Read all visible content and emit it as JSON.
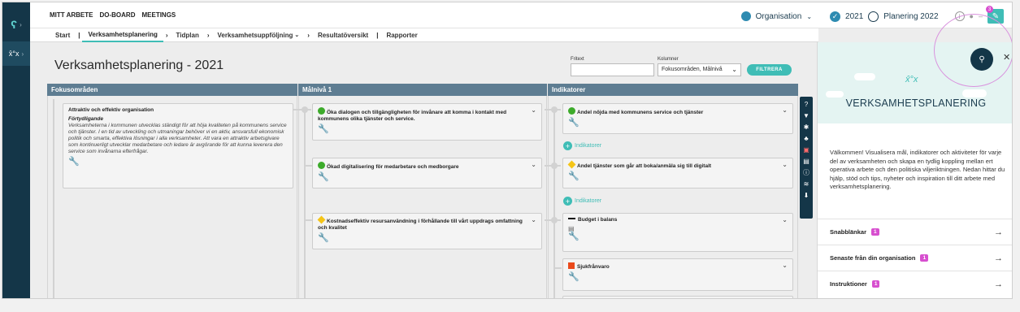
{
  "topnav": {
    "items": [
      "MITT ARBETE",
      "DO-BOARD",
      "MEETINGS"
    ]
  },
  "topbar": {
    "organisation_label": "Organisation",
    "year_label": "2021",
    "plan_label": "Planering 2022",
    "notif_count": "3"
  },
  "subnav": {
    "items": [
      {
        "label": "Start"
      },
      {
        "label": "Verksamhetsplanering"
      },
      {
        "label": "Tidplan"
      },
      {
        "label": "Verksamhetsuppföljning"
      },
      {
        "label": "Resultatöversikt"
      },
      {
        "label": "Rapporter"
      }
    ]
  },
  "page": {
    "title": "Verksamhetsplanering - 2021"
  },
  "filters": {
    "fritext_label": "Fritext",
    "fritext_value": "",
    "columns_label": "Kolumner",
    "columns_value": "Fokusområden, Målnivå",
    "button_label": "FILTRERA"
  },
  "columns": {
    "col1": "Fokusområden",
    "col2": "Målnivå 1",
    "col3": "Indikatorer"
  },
  "focus_card": {
    "title": "Attraktiv och effektiv organisation",
    "subtitle": "Förtydligande",
    "description": "Verksamheterna i kommunen utvecklas ständigt för att höja kvaliteten på kommunens service och tjänster. I en tid av utveckling och utmaningar behöver vi en aktiv, ansvarsfull ekonomisk politik och smarta, effektiva lösningar i alla verksamheter. Att vara en attraktiv arbetsgivare som kontinuerligt utvecklar medarbetare och ledare är avgörande för att kunna leverera den service som invånarna efterfrågar."
  },
  "goals": [
    {
      "status": "green",
      "title": "Öka dialogen och tillgängligheten för invånare att komma i kontakt med kommunens olika tjänster och service."
    },
    {
      "status": "green",
      "title": "Ökad digitalisering för medarbetare och medborgare"
    },
    {
      "status": "yellow",
      "title": "Kostnadseffektiv resursanvändning i förhållande till vårt uppdrags omfattning och kvalitet"
    }
  ],
  "indicators": [
    {
      "status": "green",
      "title": "Andel nöjda med kommunens service och tjänster"
    },
    {
      "status": "yellow",
      "title": "Andel tjänster som går att boka/anmäla sig till digitalt"
    },
    {
      "status": "black",
      "title": "Budget i balans"
    },
    {
      "status": "red",
      "title": "Sjukfrånvaro"
    }
  ],
  "add_indicator_label": "Indikatorer",
  "panel": {
    "title": "VERKSAMHETSPLANERING",
    "intro": "Välkommen! Visualisera mål, indikatorer och aktiviteter för varje del av verksamheten och skapa en tydlig koppling mellan ert operativa arbete och den politiska viljeriktningen.  Nedan hittar du hjälp, stöd och tips, nyheter och inspiration till ditt arbete med verksamhetsplanering.",
    "rows": [
      {
        "label": "Snabblänkar",
        "count": "1"
      },
      {
        "label": "Senaste från din organisation",
        "count": "1"
      },
      {
        "label": "Instruktioner",
        "count": "1"
      }
    ]
  },
  "colors": {
    "rail": "#143648",
    "accent": "#3fbdb6",
    "column_header": "#5e7d92",
    "badge": "#d74fcf",
    "status_green": "#3dab2b",
    "status_yellow": "#f5c518",
    "status_red": "#ea4a1c"
  }
}
